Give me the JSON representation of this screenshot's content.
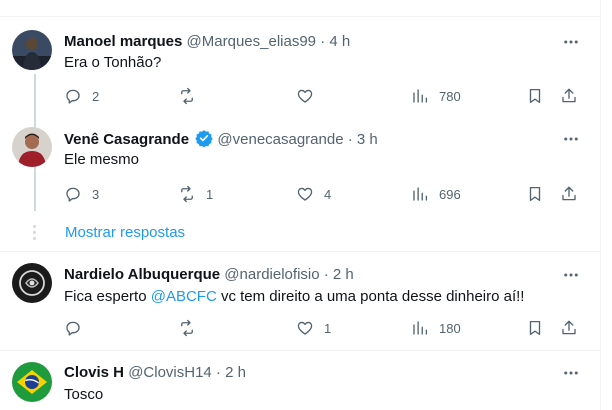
{
  "tweets": [
    {
      "name": "Manoel marques",
      "handle": "@Marques_elias99",
      "sep": "·",
      "time": "4 h",
      "text": "Era o Tonhão?",
      "replies": "2",
      "retweets": "",
      "likes": "",
      "views": "780"
    },
    {
      "name": "Venê Casagrande",
      "handle": "@venecasagrande",
      "sep": "·",
      "time": "3 h",
      "text": "Ele mesmo",
      "replies": "3",
      "retweets": "1",
      "likes": "4",
      "views": "696"
    },
    {
      "name": "Nardielo Albuquerque",
      "handle": "@nardielofisio",
      "sep": "·",
      "time": "2 h",
      "text_before": "Fica esperto ",
      "mention": "@ABCFC",
      "text_after": " vc tem direito a uma ponta desse dinheiro aí!!",
      "replies": "",
      "retweets": "",
      "likes": "1",
      "views": "180"
    },
    {
      "name": "Clovis H",
      "handle": "@ClovisH14",
      "sep": "·",
      "time": "2 h",
      "text": "Tosco"
    }
  ],
  "show_replies": "Mostrar respostas",
  "colors": {
    "accent": "#1d9bf0",
    "verified": "#1d9bf0",
    "muted": "#536471",
    "text": "#0f1419"
  },
  "icons": [
    "reply-icon",
    "retweet-icon",
    "like-icon",
    "views-icon",
    "bookmark-icon",
    "share-icon",
    "more-icon",
    "verified-badge-icon"
  ]
}
